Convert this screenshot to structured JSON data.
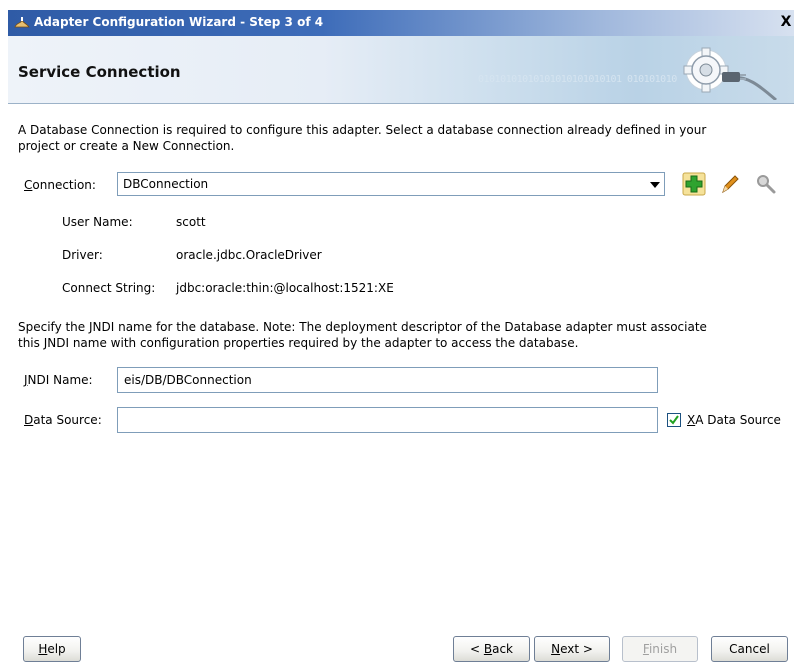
{
  "window": {
    "title": "Adapter Configuration Wizard - Step 3 of 4",
    "close_glyph": "X"
  },
  "header": {
    "title": "Service Connection",
    "binary_text": "01010101010101010101010101 010101010"
  },
  "intro": {
    "line1": "A Database Connection is required to configure this adapter. Select a database connection already defined in your",
    "line2": "project or create a New Connection."
  },
  "connection": {
    "label_underlined": "C",
    "label_rest": "onnection:",
    "selected": "DBConnection",
    "icons": [
      "add-connection-icon",
      "edit-pencil-icon",
      "browse-magnifier-icon"
    ]
  },
  "details": [
    {
      "label": "User Name:",
      "value": "scott"
    },
    {
      "label": "Driver:",
      "value": "oracle.jdbc.OracleDriver"
    },
    {
      "label": "Connect String:",
      "value": "jdbc:oracle:thin:@localhost:1521:XE"
    }
  ],
  "jndi_note": {
    "line1": "Specify the JNDI name for the database.  Note: The deployment descriptor of the Database adapter must associate",
    "line2": "this JNDI name with configuration properties required by the adapter to access the database."
  },
  "jndi": {
    "label_underlined": "J",
    "label_rest": "NDI Name:",
    "value": "eis/DB/DBConnection"
  },
  "datasource": {
    "label_underlined": "D",
    "label_rest": "ata Source:",
    "value": "",
    "xa_checked": true,
    "xa_label_underlined": "X",
    "xa_label_rest": "A Data Source"
  },
  "buttons": {
    "help_u": "H",
    "help_rest": "elp",
    "back_pre": "< ",
    "back_u": "B",
    "back_rest": "ack",
    "next_u": "N",
    "next_rest": "ext >",
    "finish_u": "F",
    "finish_rest": "inish",
    "cancel": "Cancel"
  },
  "colors": {
    "accent": "#2f5ba6",
    "add_icon": "#2fa32f",
    "pencil": "#e0901c"
  }
}
